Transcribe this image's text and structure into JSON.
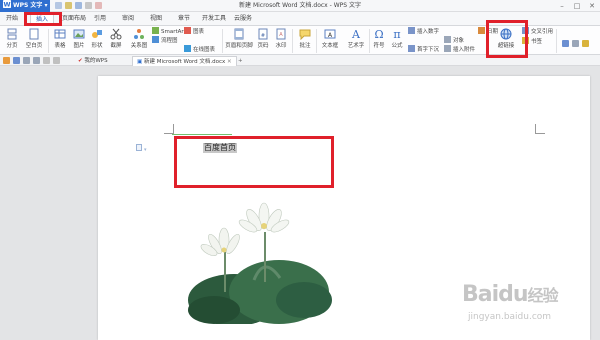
{
  "app": {
    "name": "WPS 文字",
    "window_title": "新建 Microsoft Word 文档.docx - WPS 文字"
  },
  "menu_tabs": [
    "开始",
    "插入",
    "页面布局",
    "引用",
    "审阅",
    "视图",
    "章节",
    "开发工具",
    "云服务"
  ],
  "active_menu_tab": "插入",
  "ribbon": {
    "page_break": "分页",
    "blank_page": "空白页",
    "table": "表格",
    "picture": "图片",
    "shapes": "形状",
    "screenshot": "截屏",
    "smartart": "SmartArt",
    "chart": "图表",
    "online_chart": "在线图表",
    "relation_chart": "关系图",
    "flowchart": "流程图",
    "header_footer": "页眉和页脚",
    "page_number": "页码",
    "watermark": "水印",
    "comment": "批注",
    "text_box": "文本框",
    "wordart": "艺术字",
    "symbol": "符号",
    "formula": "公式",
    "insert_number": "插入数字",
    "first_drop_cap": "首字下沉",
    "date": "日期",
    "object": "对象",
    "attachment": "插入附件",
    "hyperlink": "超链接",
    "cross_reference": "交叉引用",
    "bookmark": "书签"
  },
  "quick_toolbar": {
    "tabs": [
      "我的WPS",
      "新建 Microsoft Word 文档.docx"
    ],
    "active_tab": "新建 Microsoft Word 文档.docx"
  },
  "document": {
    "selected_text": "百度首页"
  },
  "watermark": {
    "brand": "Baidu",
    "brand_suffix": "经验",
    "url": "jingyan.baidu.com"
  },
  "colors": {
    "accent": "#2f6fd0",
    "annotation": "#e0202a"
  }
}
